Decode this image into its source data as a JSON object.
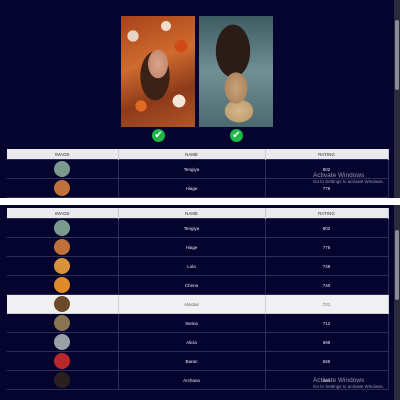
{
  "comparison": {
    "left_photo": {
      "alt": "woman among orange flowers",
      "selected": true,
      "check_icon": "check-circle-icon"
    },
    "right_photo": {
      "alt": "woman with hair flowing underwater",
      "selected": true,
      "check_icon": "check-circle-icon"
    },
    "check_color": "#1db948"
  },
  "table_headers": {
    "image": "IMAGE",
    "name": "NAME",
    "rating": "RATING"
  },
  "top_rows": [
    {
      "name": "Tengiya",
      "rating": "802"
    },
    {
      "name": "Hiage",
      "rating": "776"
    }
  ],
  "rows": [
    {
      "name": "Tengiya",
      "rating": "802",
      "highlight": false,
      "avatar_color": "#7a9a8f"
    },
    {
      "name": "Hiage",
      "rating": "776",
      "highlight": false,
      "avatar_color": "#c0703a"
    },
    {
      "name": "Lola",
      "rating": "748",
      "highlight": false,
      "avatar_color": "#d8923a"
    },
    {
      "name": "Chena",
      "rating": "740",
      "highlight": false,
      "avatar_color": "#e08a2a"
    },
    {
      "name": "Alastair",
      "rating": "721",
      "highlight": true,
      "avatar_color": "#6b4a2a"
    },
    {
      "name": "Steina",
      "rating": "712",
      "highlight": false,
      "avatar_color": "#8a7450"
    },
    {
      "name": "Alicia",
      "rating": "698",
      "highlight": false,
      "avatar_color": "#9aa0a6"
    },
    {
      "name": "Baran",
      "rating": "665",
      "highlight": false,
      "avatar_color": "#b8282a"
    },
    {
      "name": "Archana",
      "rating": "663",
      "highlight": false,
      "avatar_color": "#2a2020"
    }
  ],
  "watermark": {
    "title": "Activate Windows",
    "subtitle": "Go to Settings to activate Windows."
  },
  "colors": {
    "background": "#04042e",
    "header_bg": "#e9e9ee",
    "highlight_bg": "#f0f0f3"
  }
}
